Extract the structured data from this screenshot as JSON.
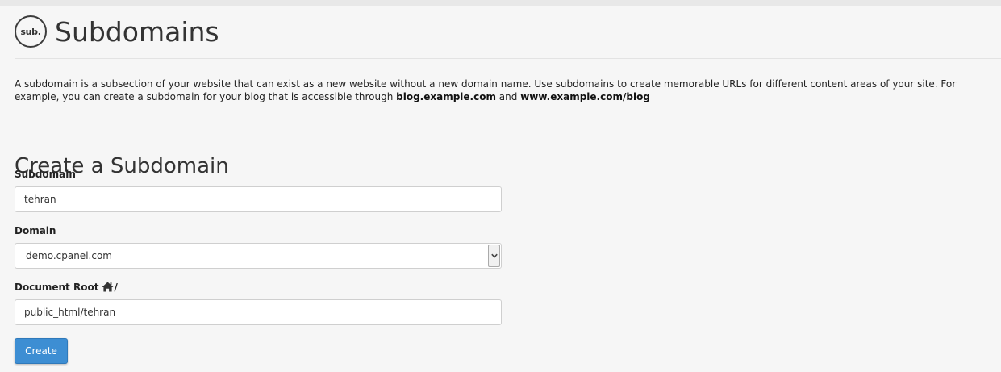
{
  "page": {
    "logo_text": "sub.",
    "title": "Subdomains",
    "description": {
      "part1": "A subdomain is a subsection of your website that can exist as a new website without a new domain name. Use subdomains to create memorable URLs for different content areas of your site. For",
      "part2": "example, you can create a subdomain for your blog that is accessible through ",
      "example1": "blog.example.com",
      "and": " and ",
      "example2": "www.example.com/blog"
    }
  },
  "form": {
    "section_title": "Create a Subdomain",
    "subdomain_label": "Subdomain",
    "subdomain_value": "tehran",
    "domain_label": "Domain",
    "domain_value": "demo.cpanel.com",
    "docroot_label": "Document Root",
    "docroot_suffix": "/",
    "docroot_value": "public_html/tehran",
    "submit_label": "Create"
  }
}
